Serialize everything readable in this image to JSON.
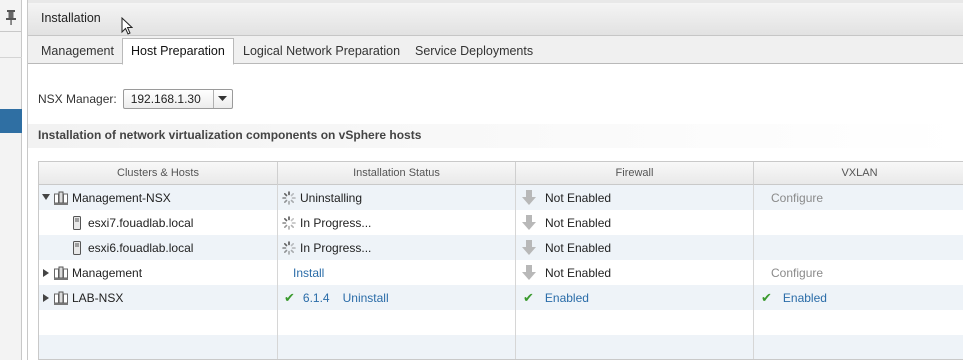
{
  "panel": {
    "title": "Installation"
  },
  "tabs": [
    {
      "label": "Management"
    },
    {
      "label": "Host Preparation",
      "active": true
    },
    {
      "label": "Logical Network Preparation"
    },
    {
      "label": "Service Deployments"
    }
  ],
  "nsx_manager": {
    "label": "NSX Manager:",
    "value": "192.168.1.30"
  },
  "section": {
    "title": "Installation of network virtualization components on vSphere hosts"
  },
  "grid": {
    "columns": [
      "Clusters & Hosts",
      "Installation Status",
      "Firewall",
      "VXLAN"
    ],
    "rows": [
      {
        "name": "Management-NSX",
        "status": "Uninstalling",
        "firewall": "Not Enabled",
        "vxlan": "Configure"
      },
      {
        "name": "esxi7.fouadlab.local",
        "status": "In Progress...",
        "firewall": "Not Enabled",
        "vxlan": ""
      },
      {
        "name": "esxi6.fouadlab.local",
        "status": "In Progress...",
        "firewall": "Not Enabled",
        "vxlan": ""
      },
      {
        "name": "Management",
        "status": "Install",
        "firewall": "Not Enabled",
        "vxlan": "Configure"
      },
      {
        "name": "LAB-NSX",
        "version": "6.1.4",
        "status": "Uninstall",
        "firewall": "Enabled",
        "vxlan": "Enabled"
      }
    ]
  },
  "colors": {
    "link": "#2a6ca8",
    "check": "#3a9a2e",
    "selection": "#2f6fa3"
  },
  "icons": [
    "pin-icon",
    "cluster-icon",
    "host-icon",
    "spinner-icon",
    "down-arrow-icon",
    "check-icon",
    "expand-icon",
    "collapse-icon",
    "chevron-down-icon",
    "cursor-icon"
  ]
}
